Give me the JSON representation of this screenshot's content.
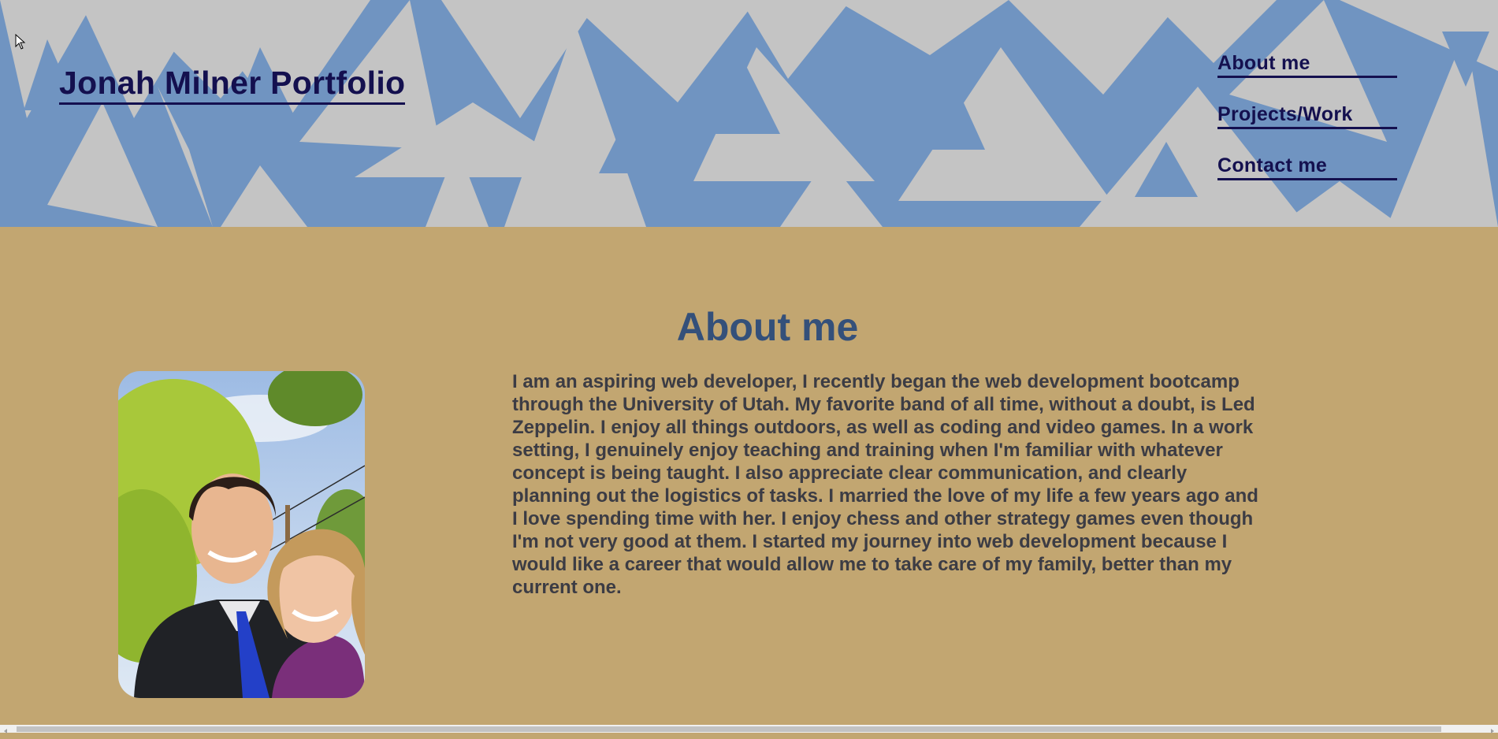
{
  "header": {
    "site_title": "Jonah Milner Portfolio",
    "nav": [
      {
        "label": "About me"
      },
      {
        "label": "Projects/Work"
      },
      {
        "label": "Contact me"
      }
    ]
  },
  "about": {
    "title": "About me",
    "photo_alt": "Jonah Milner and his wife smiling outdoors",
    "bio": "I am an aspiring web developer, I recently began the web development bootcamp through the University of Utah. My favorite band of all time, without a doubt, is Led Zeppelin. I enjoy all things outdoors, as well as coding and video games. In a work setting, I genuinely enjoy teaching and training when I'm familiar with whatever concept is being taught. I also appreciate clear communication, and clearly planning out the logistics of tasks. I married the love of my life a few years ago and I love spending time with her. I enjoy chess and other strategy games even though I'm not very good at them. I started my journey into web development because I would like a career that would allow me to take care of my family, better than my current one."
  },
  "colors": {
    "header_blue": "#7094c1",
    "triangle_gray": "#c4c4c4",
    "page_tan": "#c2a671",
    "nav_navy": "#14104f",
    "heading_blue": "#34507a",
    "body_text": "#3c3c44"
  },
  "icons": {
    "cursor": "mouse-pointer-icon",
    "scroll_left": "scroll-left-arrow-icon",
    "scroll_right": "scroll-right-arrow-icon"
  }
}
